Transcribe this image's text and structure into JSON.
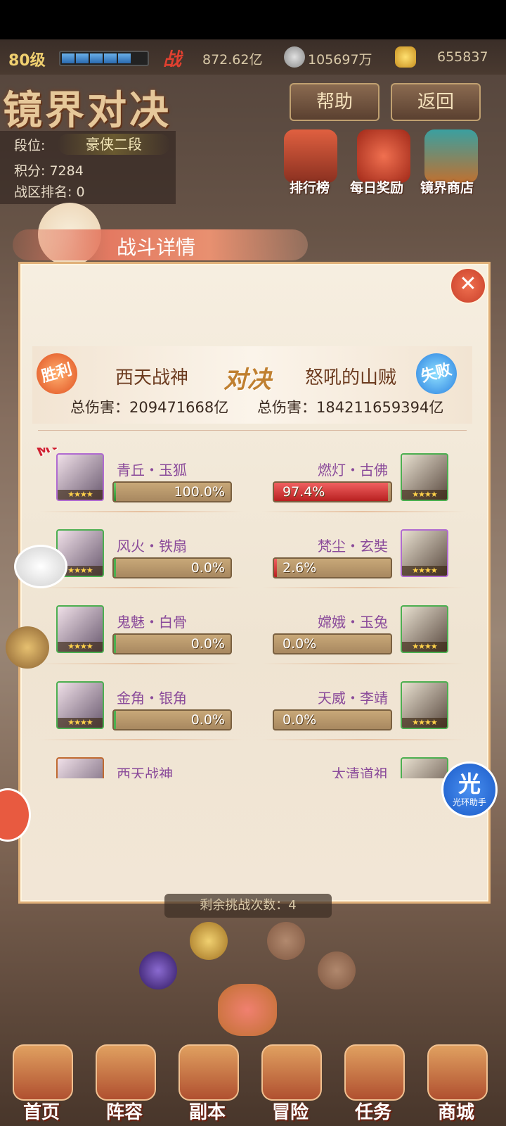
{
  "top_bar": {
    "level": "80级",
    "battle_power_label": "战",
    "battle_power": "872.62亿",
    "silver": "105697万",
    "gold": "655837",
    "exp_segments": 5
  },
  "header": {
    "title": "镜界对决",
    "help_label": "帮助",
    "back_label": "返回"
  },
  "player_info": {
    "rank_label": "段位:",
    "rank_value": "豪侠二段",
    "score": "积分: 7284",
    "zone_rank": "战区排名: 0"
  },
  "shortcuts": [
    {
      "label": "排行榜",
      "icon": "leaderboard-icon"
    },
    {
      "label": "每日奖励",
      "icon": "gift-bag-icon"
    },
    {
      "label": "镜界商店",
      "icon": "shop-chest-icon"
    }
  ],
  "popup": {
    "title": "战斗详情",
    "close_icon": "close-icon",
    "vs_text": "对决",
    "left": {
      "name": "西天战神",
      "result": "胜利",
      "damage": "总伤害：209471668亿"
    },
    "right": {
      "name": "怒吼的山贼",
      "result": "失败",
      "damage": "总伤害：184211659394亿"
    },
    "mvp_label": "MVP",
    "rows": [
      {
        "left": {
          "name": "青丘・玉狐",
          "pct": 100.0,
          "text": "100.0%",
          "border": "#b06ad0"
        },
        "right": {
          "name": "燃灯・古佛",
          "pct": 97.4,
          "text": "97.4%",
          "border": "#4caf50"
        }
      },
      {
        "left": {
          "name": "风火・铁扇",
          "pct": 0.0,
          "text": "0.0%",
          "border": "#4caf50"
        },
        "right": {
          "name": "梵尘・玄奘",
          "pct": 2.6,
          "text": "2.6%",
          "border": "#b06ad0"
        }
      },
      {
        "left": {
          "name": "鬼魅・白骨",
          "pct": 0.0,
          "text": "0.0%",
          "border": "#4caf50"
        },
        "right": {
          "name": "嫦娥・玉兔",
          "pct": 0.0,
          "text": "0.0%",
          "border": "#4caf50"
        }
      },
      {
        "left": {
          "name": "金角・银角",
          "pct": 0.0,
          "text": "0.0%",
          "border": "#4caf50"
        },
        "right": {
          "name": "天威・李靖",
          "pct": 0.0,
          "text": "0.0%",
          "border": "#4caf50"
        }
      },
      {
        "left": {
          "name": "西天战神",
          "pct": null,
          "text": "",
          "border": "#c06a30"
        },
        "right": {
          "name": "太清道祖",
          "pct": null,
          "text": "",
          "border": "#4caf50"
        }
      }
    ],
    "stars": "★★★★",
    "colors": {
      "left_fill": "#4caf50",
      "right_fill": "#d83030",
      "name": "#8a4a9a"
    }
  },
  "remaining_challenges": "剩余挑战次数：4",
  "floating": {
    "assistant_label": "光环助手",
    "assistant_glyph": "光"
  },
  "bottom_nav": [
    {
      "label": "首页",
      "icon": "home-icon"
    },
    {
      "label": "阵容",
      "icon": "formation-icon"
    },
    {
      "label": "副本",
      "icon": "dungeon-icon"
    },
    {
      "label": "冒险",
      "icon": "adventure-icon"
    },
    {
      "label": "任务",
      "icon": "quest-icon"
    },
    {
      "label": "商城",
      "icon": "mall-icon"
    }
  ]
}
